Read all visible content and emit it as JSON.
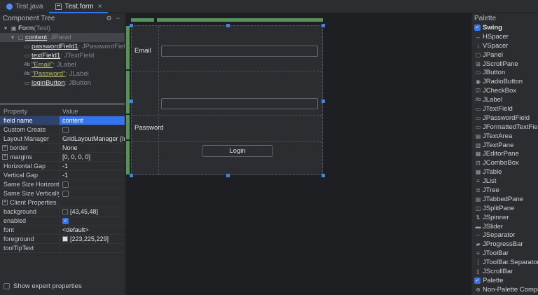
{
  "glyphs": {
    "gear": "⚙",
    "minimize": "−",
    "close": "×",
    "check": "✓",
    "plus": "+",
    "arrow_expanded": "▾"
  },
  "colors": {
    "accent_blue": "#3574f0",
    "selection_row_blue": "#2e436e",
    "grid_header_green": "#5c8f5e",
    "panel_background": "#2b2d30",
    "canvas_background": "#1e1f22"
  },
  "tabs": [
    {
      "label": "Test.java",
      "active": false
    },
    {
      "label": "Test.form",
      "active": true
    }
  ],
  "component_tree": {
    "title": "Component Tree",
    "items": [
      {
        "glyph": "▣",
        "name": "Form",
        "type": " (Test)"
      },
      {
        "glyph": "▢",
        "name": "content",
        "type": " : JPanel",
        "selected": true
      },
      {
        "glyph": "▭",
        "name": "passwordField1",
        "type": " : JPasswordField"
      },
      {
        "glyph": "▭",
        "name": "textField1",
        "type": " : JTextField"
      },
      {
        "glyph": "Ab",
        "name": "\"Email\"",
        "type": " : JLabel"
      },
      {
        "glyph": "Ab",
        "name": "\"Password\"",
        "type": " : JLabel"
      },
      {
        "glyph": "▭",
        "name": "loginButton",
        "type": " : JButton"
      }
    ]
  },
  "properties": {
    "headers": {
      "property": "Property",
      "value": "Value"
    },
    "rows": [
      {
        "name": "field name",
        "value": "content",
        "selected": true
      },
      {
        "name": "Custom Create",
        "checkbox": true,
        "checked": false
      },
      {
        "name": "Layout Manager",
        "value": "GridLayoutManager (In..."
      },
      {
        "name": "border",
        "value": "None",
        "expandable": true
      },
      {
        "name": "margins",
        "value": "[0, 0, 0, 0]",
        "expandable": true
      },
      {
        "name": "Horizontal Gap",
        "value": "-1"
      },
      {
        "name": "Vertical Gap",
        "value": "-1"
      },
      {
        "name": "Same Size Horizontally",
        "checkbox": true,
        "checked": false
      },
      {
        "name": "Same Size Vertically",
        "checkbox": true,
        "checked": false
      },
      {
        "name": "Client Properties",
        "value": "",
        "expandable": true
      },
      {
        "name": "background",
        "value": "[43,45,48]",
        "swatch": "#2b2d30"
      },
      {
        "name": "enabled",
        "checkbox": true,
        "checked": true
      },
      {
        "name": "font",
        "value": "<default>"
      },
      {
        "name": "foreground",
        "value": "[223,225,229]",
        "swatch": "#dfe1e5"
      },
      {
        "name": "toolTipText",
        "value": ""
      }
    ],
    "show_expert_label": "Show expert properties"
  },
  "designer": {
    "email_label": "Email",
    "password_label": "Password",
    "login_button_label": "Login"
  },
  "palette": {
    "title": "Palette",
    "items": [
      {
        "label": "Swing",
        "checked": true
      },
      {
        "label": "HSpacer",
        "glyph": "↔"
      },
      {
        "label": "VSpacer",
        "glyph": "↕"
      },
      {
        "label": "JPanel",
        "glyph": "▢"
      },
      {
        "label": "JScrollPane",
        "glyph": "⊞"
      },
      {
        "label": "JButton",
        "glyph": "▭"
      },
      {
        "label": "JRadioButton",
        "glyph": "◉"
      },
      {
        "label": "JCheckBox",
        "glyph": "☑"
      },
      {
        "label": "JLabel",
        "glyph": "Ab"
      },
      {
        "label": "JTextField",
        "glyph": "▭"
      },
      {
        "label": "JPasswordField",
        "glyph": "▭"
      },
      {
        "label": "JFormattedTextField",
        "glyph": "▭"
      },
      {
        "label": "JTextArea",
        "glyph": "▤"
      },
      {
        "label": "JTextPane",
        "glyph": "▥"
      },
      {
        "label": "JEditorPane",
        "glyph": "▦"
      },
      {
        "label": "JComboBox",
        "glyph": "⊟"
      },
      {
        "label": "JTable",
        "glyph": "▦"
      },
      {
        "label": "JList",
        "glyph": "≡"
      },
      {
        "label": "JTree",
        "glyph": "≣"
      },
      {
        "label": "JTabbedPane",
        "glyph": "▤"
      },
      {
        "label": "JSplitPane",
        "glyph": "◫"
      },
      {
        "label": "JSpinner",
        "glyph": "⇅"
      },
      {
        "label": "JSlider",
        "glyph": "▬"
      },
      {
        "label": "JSeparator",
        "glyph": "─"
      },
      {
        "label": "JProgressBar",
        "glyph": "▰"
      },
      {
        "label": "JToolBar",
        "glyph": "≡"
      },
      {
        "label": "JToolBar.Separator",
        "glyph": "┆"
      },
      {
        "label": "JScrollBar",
        "glyph": "▯"
      },
      {
        "label": "Palette",
        "checked": true
      },
      {
        "label": "Non-Palette Component",
        "glyph": "⊕"
      }
    ]
  }
}
